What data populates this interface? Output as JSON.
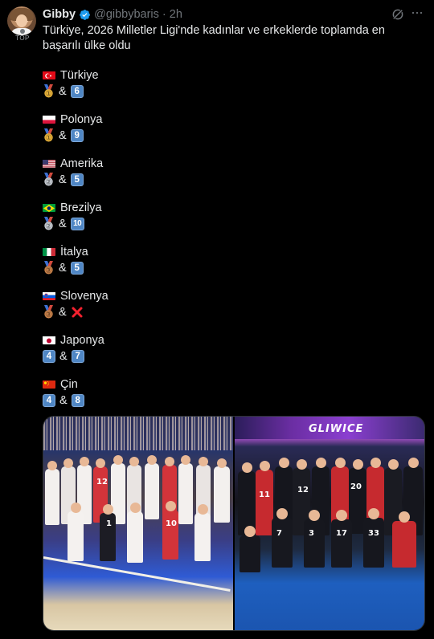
{
  "post": {
    "author_name": "Gibby",
    "handle": "@gibbybaris",
    "separator": "·",
    "time": "2h",
    "badge": "TOP",
    "text": "Türkiye, 2026 Milletler Ligi'nde kadınlar ve erkeklerde toplamda en başarılı ülke oldu"
  },
  "countries": [
    {
      "name": "Türkiye",
      "flag": "tr-flag",
      "women": {
        "type": "medal",
        "medal": "gold"
      },
      "amp": "&",
      "men": {
        "type": "number",
        "value": "6"
      }
    },
    {
      "name": "Polonya",
      "flag": "pl-flag",
      "women": {
        "type": "medal",
        "medal": "gold"
      },
      "amp": "&",
      "men": {
        "type": "number",
        "value": "9"
      }
    },
    {
      "name": "Amerika",
      "flag": "us-flag",
      "women": {
        "type": "medal",
        "medal": "silver"
      },
      "amp": "&",
      "men": {
        "type": "number",
        "value": "5"
      }
    },
    {
      "name": "Brezilya",
      "flag": "br-flag",
      "women": {
        "type": "medal",
        "medal": "silver"
      },
      "amp": "&",
      "men": {
        "type": "number",
        "value": "10"
      }
    },
    {
      "name": "İtalya",
      "flag": "it-flag",
      "women": {
        "type": "medal",
        "medal": "bronze"
      },
      "amp": "&",
      "men": {
        "type": "number",
        "value": "5"
      }
    },
    {
      "name": "Slovenya",
      "flag": "si-flag",
      "women": {
        "type": "medal",
        "medal": "bronze"
      },
      "amp": "&",
      "men": {
        "type": "cross"
      }
    },
    {
      "name": "Japonya",
      "flag": "jp-flag",
      "women": {
        "type": "number",
        "value": "4"
      },
      "amp": "&",
      "men": {
        "type": "number",
        "value": "7"
      }
    },
    {
      "name": "Çin",
      "flag": "cn-flag",
      "women": {
        "type": "number",
        "value": "4"
      },
      "amp": "&",
      "men": {
        "type": "number",
        "value": "8"
      }
    }
  ],
  "media": {
    "banner_text": "GLIWICE",
    "jersey_numbers_right": [
      "11",
      "7",
      "3",
      "17",
      "33",
      "20",
      "12"
    ],
    "jersey_numbers_left": [
      "12",
      "1",
      "10"
    ]
  },
  "colors": {
    "background": "#000000",
    "text": "#e7e9ea",
    "muted": "#71767b",
    "verified": "#1d9bf0",
    "keycap": "#4f86c4",
    "gold": "#e8b23a",
    "silver": "#c7ccd3",
    "bronze": "#c9824a"
  }
}
